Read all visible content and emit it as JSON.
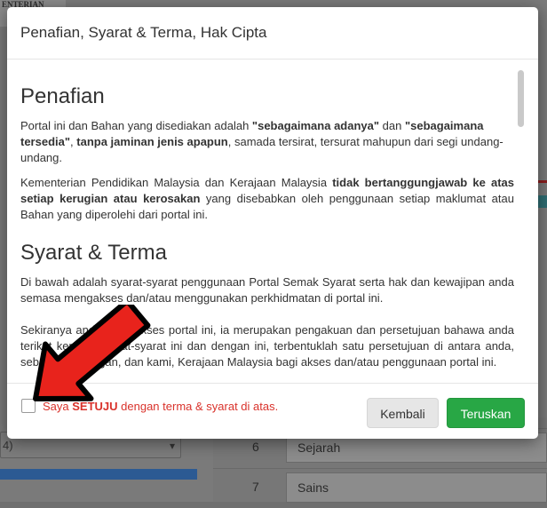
{
  "background": {
    "logo_text": "ENTERIAN",
    "left_select_value": "4)",
    "rows": [
      {
        "num": "6",
        "subject": "Sejarah"
      },
      {
        "num": "7",
        "subject": "Sains"
      }
    ]
  },
  "modal": {
    "title": "Penafian, Syarat & Terma, Hak Cipta",
    "sections": {
      "penafian_heading": "Penafian",
      "penafian_p1": {
        "t1": "Portal ini dan Bahan yang disediakan adalah ",
        "b1": "\"sebagaimana adanya\"",
        "t2": " dan ",
        "b2": "\"sebagaimana tersedia\"",
        "t3": ", ",
        "b3": "tanpa jaminan jenis apapun",
        "t4": ", samada tersirat, tersurat mahupun dari segi undang-undang."
      },
      "penafian_p2": {
        "t1": "Kementerian Pendidikan Malaysia dan Kerajaan Malaysia ",
        "b1": "tidak bertanggungjawab ke atas setiap kerugian atau kerosakan",
        "t2": " yang disebabkan oleh penggunaan setiap maklumat atau Bahan yang diperolehi dari portal ini."
      },
      "syarat_heading": "Syarat & Terma",
      "syarat_p1": "Di bawah adalah syarat-syarat penggunaan Portal Semak Syarat serta hak dan kewajipan anda semasa mengakses dan/atau menggunakan perkhidmatan di portal ini.",
      "syarat_p2": "Sekiranya anda mengakses portal ini, ia merupakan pengakuan dan persetujuan bahawa anda terikat kepada syarat-syarat ini dan dengan ini, terbentuklah satu persetujuan di antara anda, sebagai pelanggan, dan kami, Kerajaan Malaysia bagi akses dan/atau penggunaan portal ini."
    },
    "footer": {
      "agree_pre": "Saya ",
      "agree_bold": "SETUJU",
      "agree_post": " dengan terma & syarat di atas.",
      "back_label": "Kembali",
      "next_label": "Teruskan"
    }
  },
  "colors": {
    "accent_green": "#28a745",
    "agree_red": "#d9322b",
    "arrow_red": "#e8231c"
  },
  "icons": {
    "annotation": "arrow-pointer-icon"
  }
}
